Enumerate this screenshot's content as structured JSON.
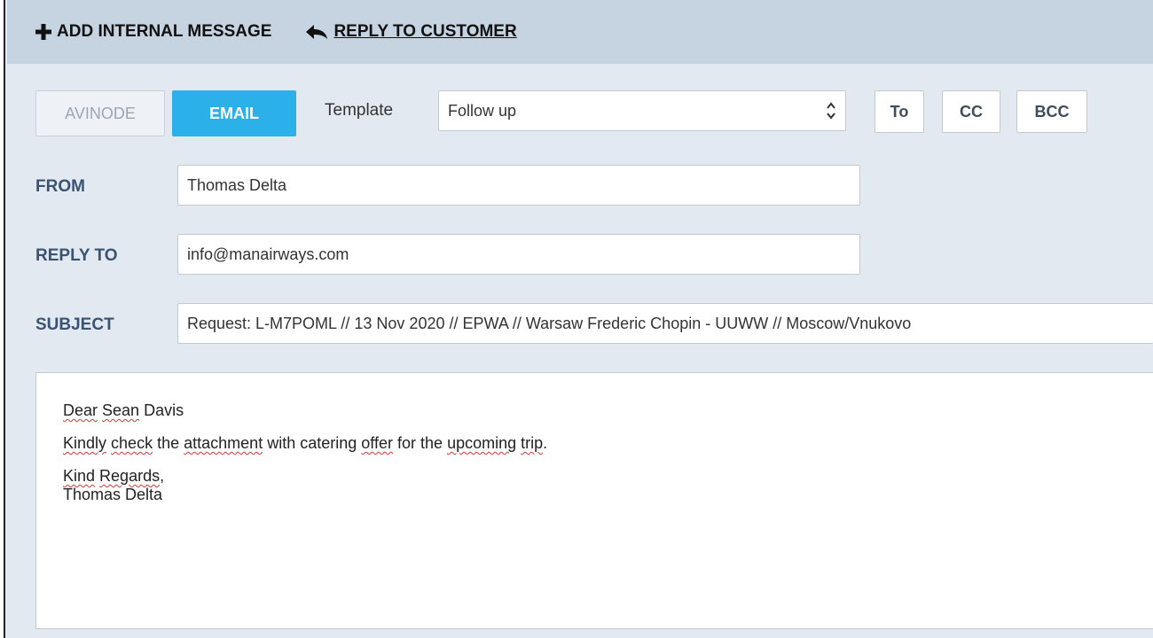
{
  "toolbar": {
    "add_internal_message": "ADD INTERNAL MESSAGE",
    "reply_to_customer": "REPLY TO CUSTOMER"
  },
  "channels": {
    "avinode": "AVINODE",
    "email": "EMAIL",
    "active": "EMAIL"
  },
  "template": {
    "label": "Template",
    "selected": "Follow up"
  },
  "recipients": {
    "to": "To",
    "cc": "CC",
    "bcc": "BCC"
  },
  "form": {
    "from_label": "FROM",
    "from_value": "Thomas Delta",
    "reply_to_label": "REPLY TO",
    "reply_to_value": "info@manairways.com",
    "subject_label": "SUBJECT",
    "subject_value": "Request: L-M7POML // 13 Nov 2020 // EPWA // Warsaw Frederic Chopin - UUWW // Moscow/Vnukovo"
  },
  "body": {
    "greeting_w1": "Dear",
    "greeting_w2": "Sean",
    "greeting_w3": "Davis",
    "line_w1": "Kindly",
    "line_w2": "check",
    "line_t1": "the",
    "line_w3": "attachment",
    "line_t2": "with catering",
    "line_w4": "offer",
    "line_t3": "for the",
    "line_w5": "upcoming",
    "line_w6": "trip",
    "line_end": ".",
    "closing_w1": "Kind",
    "closing_w2": "Regards",
    "closing_end": ",",
    "signature": "Thomas Delta"
  },
  "colors": {
    "topbar": "#c6d3e1",
    "background": "#e3e9f1",
    "email_button": "#2cb0ea",
    "label": "#3a5372",
    "spellcheck": "#d93636"
  },
  "icons": {
    "add": "plus-icon",
    "reply": "reply-arrow-icon",
    "select": "up-down-arrows-icon"
  }
}
